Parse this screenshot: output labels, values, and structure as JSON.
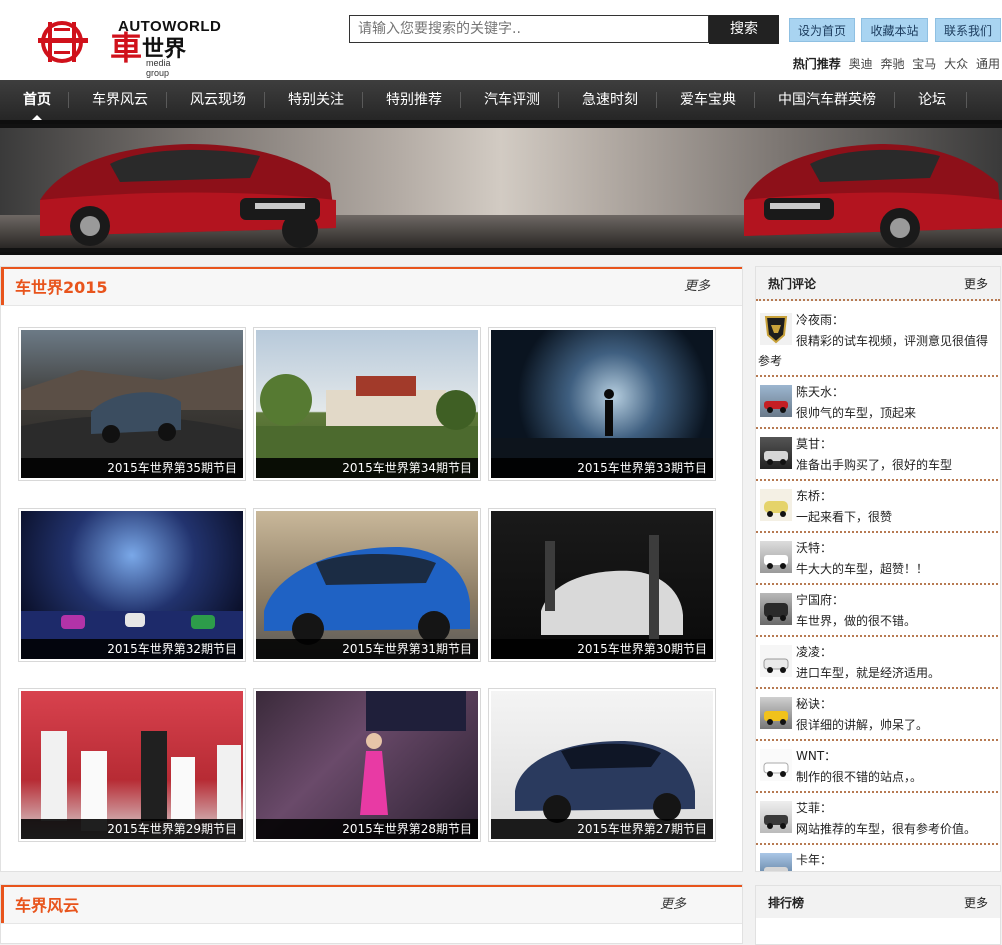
{
  "logo": {
    "en": "AUTOWORLD",
    "cn_main": "車",
    "cn_sub": "世界",
    "media": "media group"
  },
  "search": {
    "placeholder": "请输入您要搜索的关键字..",
    "button": "搜索"
  },
  "top_buttons": [
    "设为首页",
    "收藏本站",
    "联系我们"
  ],
  "hot": {
    "label": "热门推荐",
    "links": [
      "奥迪",
      "奔驰",
      "宝马",
      "大众",
      "通用"
    ]
  },
  "nav": [
    "首页",
    "车界风云",
    "风云现场",
    "特别关注",
    "特别推荐",
    "汽车评测",
    "急速时刻",
    "爱车宝典",
    "中国汽车群英榜",
    "论坛"
  ],
  "section1": {
    "title": "车世界2015",
    "more": "更多"
  },
  "videos": [
    {
      "caption": "2015车世界第35期节目",
      "scene": "suv-road"
    },
    {
      "caption": "2015车世界第34期节目",
      "scene": "palace"
    },
    {
      "caption": "2015车世界第33期节目",
      "scene": "stage-smoke"
    },
    {
      "caption": "2015车世界第32期节目",
      "scene": "light-show"
    },
    {
      "caption": "2015车世界第31期节目",
      "scene": "blue-car"
    },
    {
      "caption": "2015车世界第30期节目",
      "scene": "show-car"
    },
    {
      "caption": "2015车世界第29期节目",
      "scene": "podium"
    },
    {
      "caption": "2015车世界第28期节目",
      "scene": "pink-model"
    },
    {
      "caption": "2015车世界第27期节目",
      "scene": "rolls-royce"
    }
  ],
  "section2": {
    "title": "车界风云",
    "more": "更多"
  },
  "sidebar": {
    "comments_title": "热门评论",
    "comments_more": "更多",
    "comments": [
      {
        "user": "冷夜雨：",
        "text": "很精彩的试车视频，评测意见很值得参考"
      },
      {
        "user": "陈天水：",
        "text": "很帅气的车型，顶起来"
      },
      {
        "user": "莫甘：",
        "text": "准备出手购买了，很好的车型"
      },
      {
        "user": "东桥：",
        "text": "一起来看下，很赞"
      },
      {
        "user": "沃特：",
        "text": "牛大大的车型，超赞！！"
      },
      {
        "user": "宁国府：",
        "text": "车世界，做的很不错。"
      },
      {
        "user": "凌凌：",
        "text": "进口车型，就是经济适用。"
      },
      {
        "user": "秘诀：",
        "text": "很详细的讲解，帅呆了。"
      },
      {
        "user": "WNT：",
        "text": "制作的很不错的站点，。"
      },
      {
        "user": "艾菲：",
        "text": "网站推荐的车型，很有参考价值。"
      },
      {
        "user": "卡年：",
        "text": ""
      }
    ],
    "rank_title": "排行榜",
    "rank_more": "更多"
  },
  "colors": {
    "accent": "#e8541c",
    "nav_bg": "#2e2e2e",
    "logo_red": "#d0111b",
    "button_blue": "#a9d4f1"
  }
}
